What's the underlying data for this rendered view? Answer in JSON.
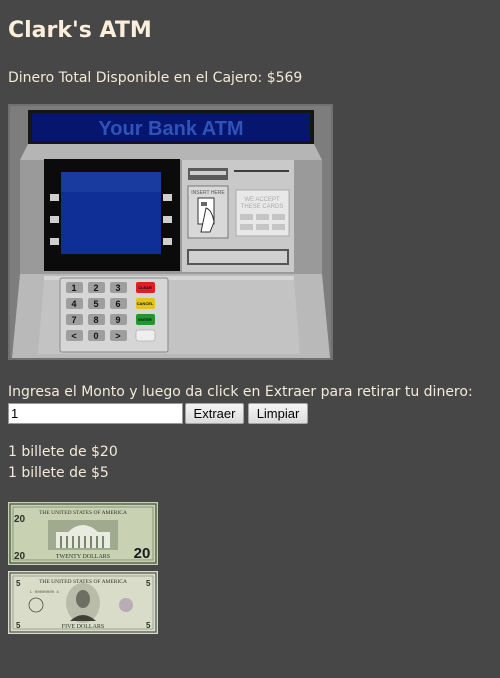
{
  "page": {
    "title": "Clark's ATM",
    "total_available": "Dinero Total Disponible en el Cajero: $569"
  },
  "atm_image": {
    "banner": "Your Bank ATM",
    "insert_label": "INSERT HERE",
    "accept_label_1": "WE ACCEPT",
    "accept_label_2": "THESE CARDS",
    "keys": [
      "1",
      "2",
      "3",
      "4",
      "5",
      "6",
      "7",
      "8",
      "9",
      "<",
      "0",
      ">"
    ],
    "cancel_key": "CANCEL",
    "clear_key": "CLEAR",
    "enter_key": "ENTER",
    "colors": {
      "banner_text": "#2f53b8",
      "screen": "#0f2f96",
      "cancel_key": "#e02020",
      "clear_key": "#e8c21a",
      "enter_key": "#1f9a2a"
    }
  },
  "form": {
    "prompt": "Ingresa el Monto y luego da click en Extraer para retirar tu dinero:",
    "amount_value": "1",
    "extract_button": "Extraer",
    "clear_button": "Limpiar"
  },
  "result": {
    "line_1": "1 billete de $20",
    "line_2": "1 billete de $5"
  },
  "bill_20": {
    "header": "THE UNITED STATES OF AMERICA",
    "footer": "TWENTY DOLLARS",
    "value": "20",
    "color": "#c9d1b3"
  },
  "bill_5": {
    "header": "THE UNITED STATES OF AMERICA",
    "footer": "FIVE DOLLARS",
    "value": "5",
    "serial": "L 00000000 4",
    "color": "#d8dcc8"
  }
}
